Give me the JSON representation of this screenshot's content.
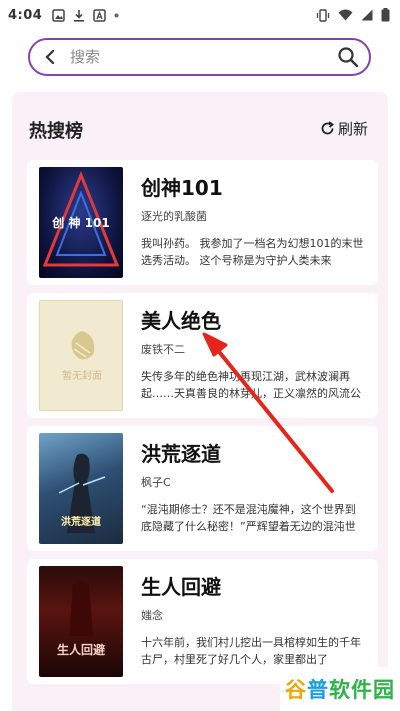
{
  "status_bar": {
    "time": "4:04"
  },
  "search": {
    "placeholder": "搜索"
  },
  "panel": {
    "title": "热搜榜",
    "refresh_label": "刷新"
  },
  "books": [
    {
      "title": "创神101",
      "author": "逐光的乳酸菌",
      "desc": "我叫孙药。 我参加了一档名为幻想101的末世选秀活动。 这个号称是为守护人类未来",
      "cover_text": "创 神 101"
    },
    {
      "title": "美人绝色",
      "author": "废铁不二",
      "desc": "失传多年的绝色神功再现江湖，武林波澜再起……天真善良的林芽儿，正义凛然的风流公",
      "cover_text": "暂无封面"
    },
    {
      "title": "洪荒逐道",
      "author": "枫子C",
      "desc": "“混沌期修士？还不是混沌魔神，这个世界到底隐藏了什么秘密！”严辉望着无边的混沌世",
      "cover_text": "洪荒逐道"
    },
    {
      "title": "生人回避",
      "author": "媸念",
      "desc": "十六年前，我们村儿挖出一具棺椁如生的千年古尸，村里死了好几个人，家里都出了",
      "cover_text": "生人回避"
    }
  ],
  "watermark": {
    "part1": "谷",
    "part2": "普",
    "part3": "软件园"
  },
  "colors": {
    "accent": "#8a3fae",
    "panel_bg": "#f9f1f6",
    "arrow": "#e5251b"
  }
}
